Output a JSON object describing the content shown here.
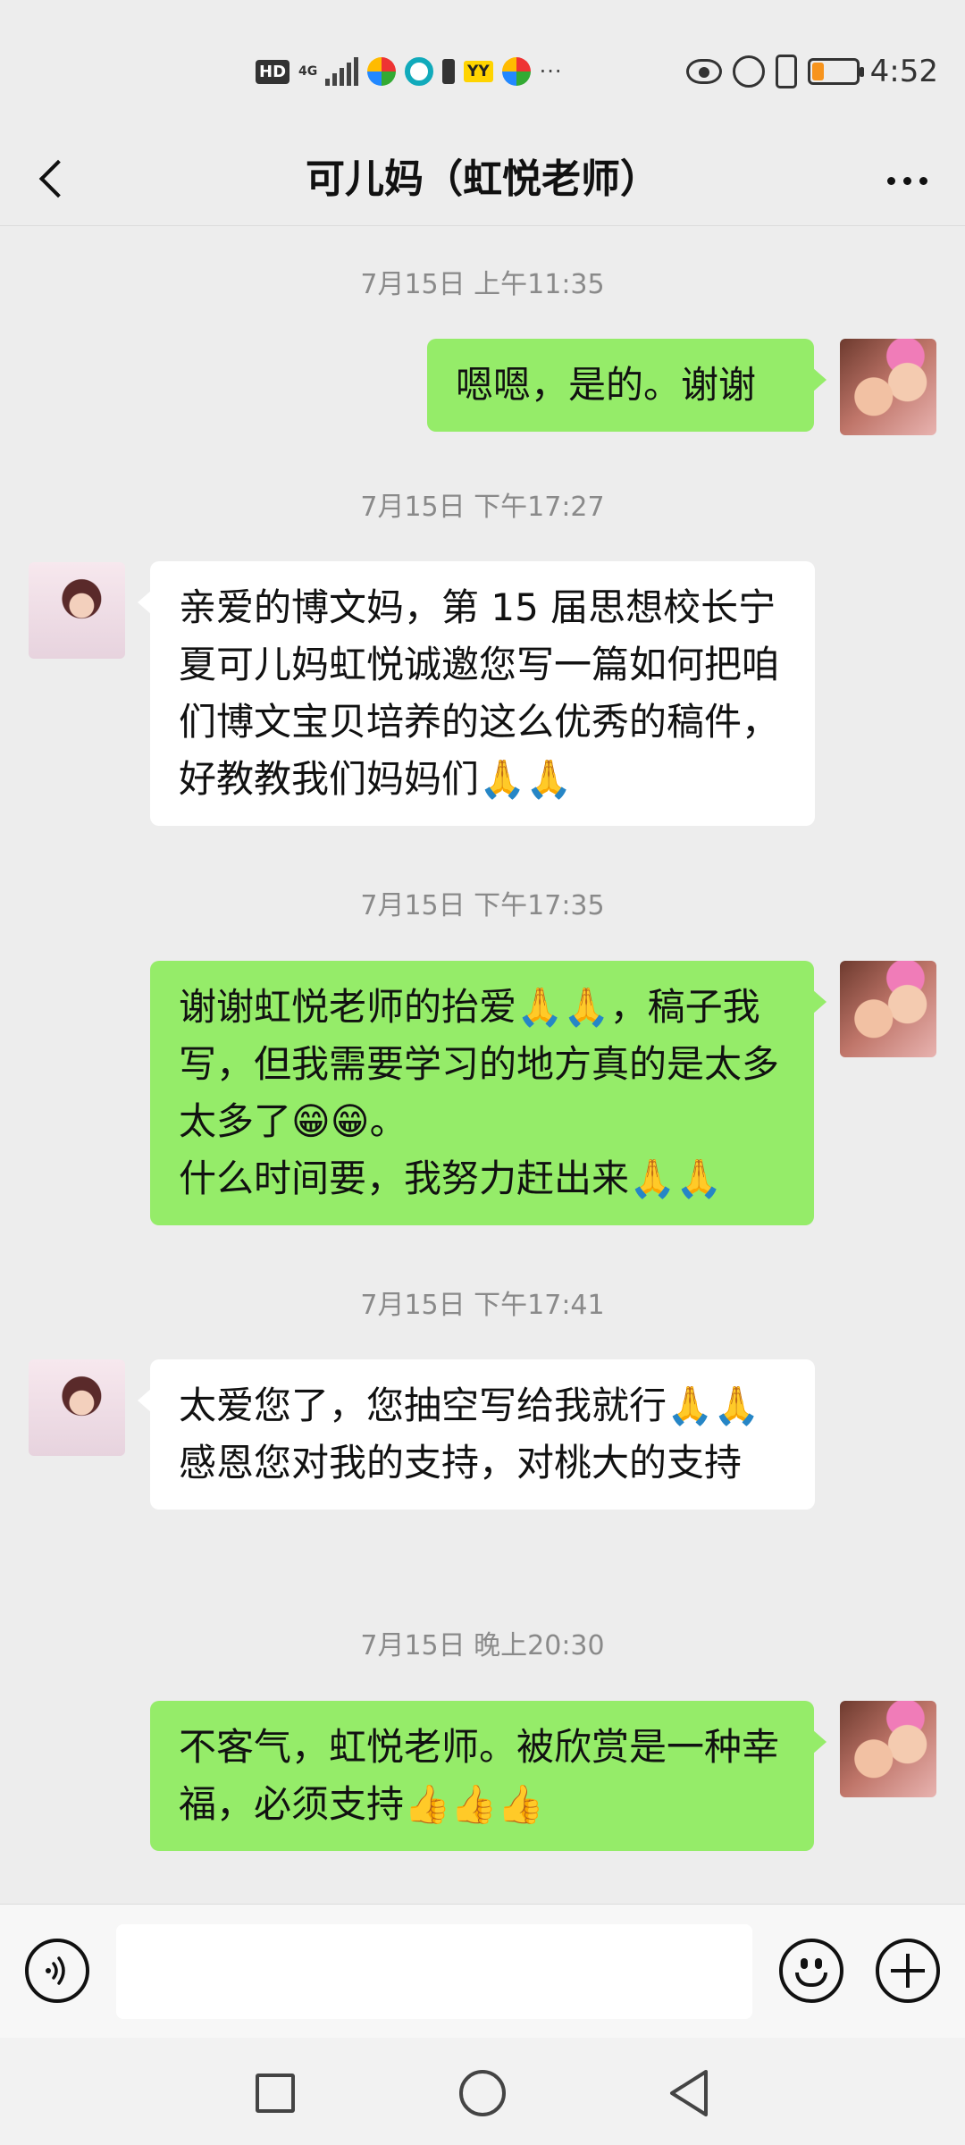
{
  "status_bar": {
    "hd": "HD",
    "network": "4G",
    "yy": "YY",
    "more": "···",
    "time": "4:52",
    "battery_level": 0.25,
    "battery_color": "#f7941d"
  },
  "header": {
    "title": "可儿妈（虹悦老师）",
    "back_icon": "chevron-left-icon",
    "more_icon": "more-horizontal-icon"
  },
  "messages": [
    {
      "timestamp": "7月15日 上午11:35",
      "sender": "self",
      "text": "嗯嗯，是的。谢谢"
    },
    {
      "timestamp": "7月15日 下午17:27",
      "sender": "other",
      "text": "亲爱的博文妈，第 15 届思想校长宁夏可儿妈虹悦诚邀您写一篇如何把咱们博文宝贝培养的这么优秀的稿件，好教教我们妈妈们🙏🙏"
    },
    {
      "timestamp": "7月15日 下午17:35",
      "sender": "self",
      "text": "谢谢虹悦老师的抬爱🙏🙏，稿子我写，但我需要学习的地方真的是太多太多了😁😁。\n什么时间要，我努力赶出来🙏🙏"
    },
    {
      "timestamp": "7月15日 下午17:41",
      "sender": "other",
      "text": "太爱您了，您抽空写给我就行🙏🙏感恩您对我的支持，对桃大的支持"
    },
    {
      "timestamp": "7月15日 晚上20:30",
      "sender": "self",
      "text": "不客气，虹悦老师。被欣赏是一种幸福，必须支持👍👍👍"
    }
  ],
  "input_bar": {
    "placeholder": "",
    "voice_icon": "voice-icon",
    "emoji_icon": "emoji-icon",
    "plus_icon": "plus-icon"
  },
  "colors": {
    "outgoing_bubble": "#95ec69",
    "incoming_bubble": "#ffffff",
    "background": "#ededed",
    "timestamp": "#8a8a8a"
  }
}
